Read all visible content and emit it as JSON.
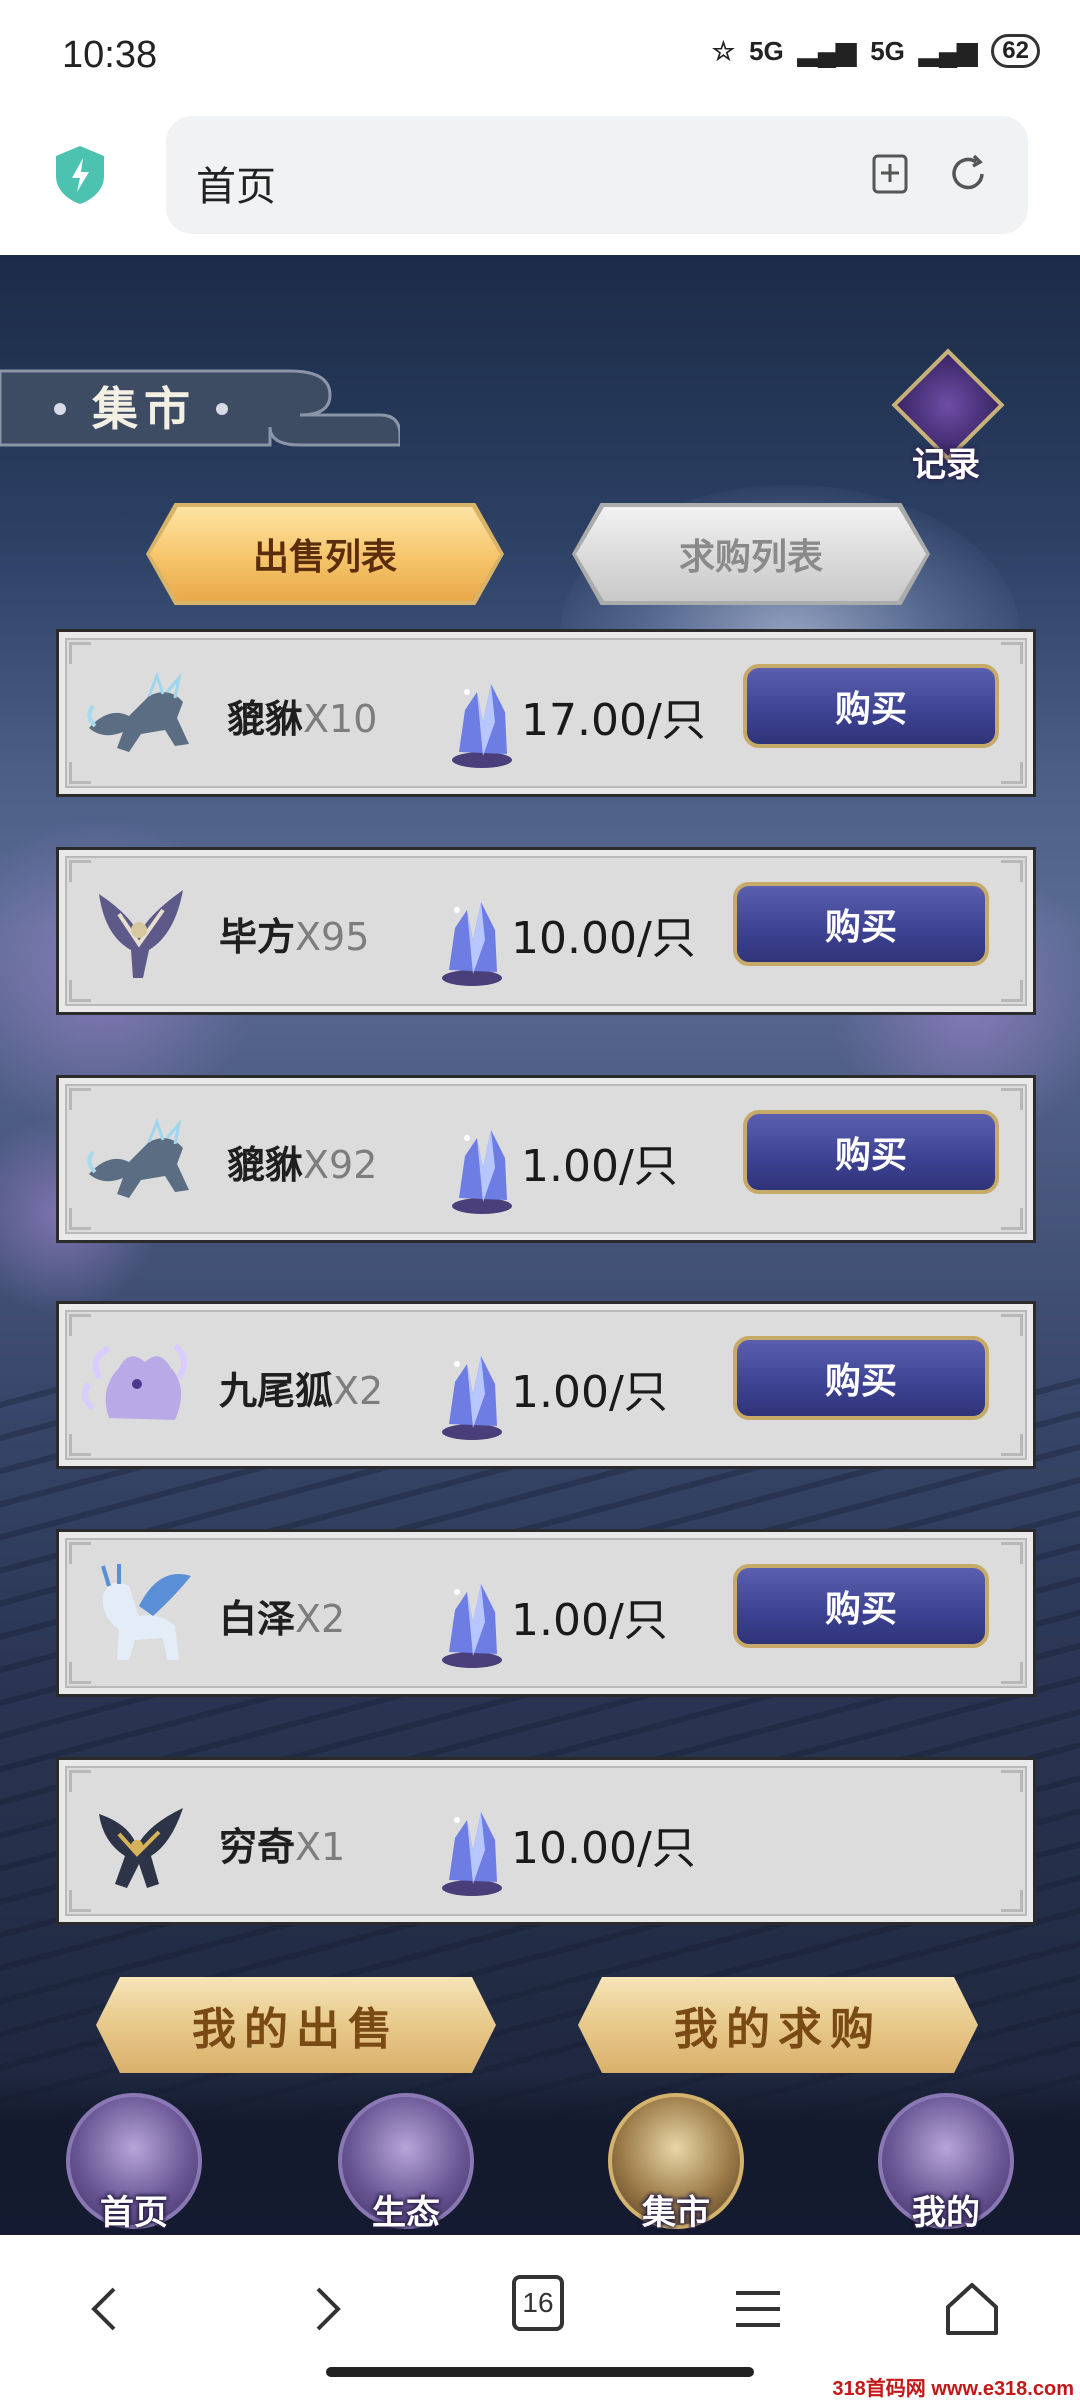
{
  "status": {
    "time": "10:38",
    "signal1": "5G",
    "signal2": "5G",
    "battery": "62"
  },
  "browser": {
    "url_title": "首页"
  },
  "market": {
    "title": "集市",
    "record_label": "记录",
    "tabs": {
      "sell": "出售列表",
      "buy": "求购列表"
    },
    "listings": [
      {
        "name": "貔貅",
        "count": "X10",
        "price": "17.00/只",
        "button": "购买"
      },
      {
        "name": "毕方",
        "count": "X95",
        "price": "10.00/只",
        "button": "购买"
      },
      {
        "name": "貔貅",
        "count": "X92",
        "price": "1.00/只",
        "button": "购买"
      },
      {
        "name": "九尾狐",
        "count": "X2",
        "price": "1.00/只",
        "button": "购买"
      },
      {
        "name": "白泽",
        "count": "X2",
        "price": "1.00/只",
        "button": "购买"
      },
      {
        "name": "穷奇",
        "count": "X1",
        "price": "10.00/只",
        "button": ""
      }
    ],
    "my_sell": "我的出售",
    "my_buy": "我的求购"
  },
  "nav": [
    {
      "label": "首页",
      "icon": "gate-icon"
    },
    {
      "label": "生态",
      "icon": "mountain-icon"
    },
    {
      "label": "集市",
      "icon": "market-icon"
    },
    {
      "label": "我的",
      "icon": "character-icon"
    }
  ],
  "toolbar": {
    "tab_count": "16"
  },
  "watermark": "318首码网 www.e318.com"
}
